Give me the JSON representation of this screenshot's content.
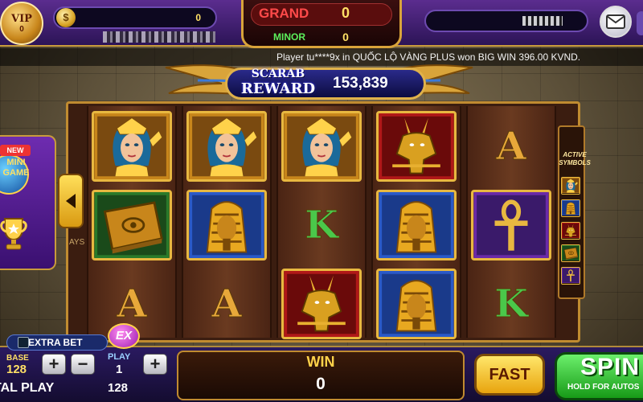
{
  "topbar": {
    "vip_label": "VIP",
    "vip_level": "0",
    "coin_symbol": "$",
    "coin_balance": "0"
  },
  "jackpot": {
    "grand_label": "GRAND",
    "grand_value": "0",
    "minor_label": "MINOR",
    "minor_value": "0"
  },
  "ticker": {
    "message": "Player tu****9x in  QUỐC LỘ VÀNG PLUS  won  BIG WIN 396.00 KVND."
  },
  "reward": {
    "title_line1": "SCARAB",
    "title_line2": "REWARD",
    "value": "153,839"
  },
  "reels": [
    [
      "queen",
      "book",
      "A"
    ],
    [
      "queen",
      "pharaoh",
      "A"
    ],
    [
      "queen",
      "K",
      "anubis"
    ],
    [
      "anubis",
      "pharaoh",
      "pharaoh"
    ],
    [
      "A",
      "ankh",
      "K"
    ]
  ],
  "side": {
    "mini_badge": "NEW",
    "mini_label": "MINI GAME",
    "side_text": "AYS"
  },
  "active_symbols": {
    "title": "ACTIVE SYMBOLS",
    "icons": [
      "queen",
      "pharaoh",
      "anubis",
      "book",
      "ankh"
    ]
  },
  "bottom": {
    "extra_bet_label": "EXTRA BET",
    "ex_label": "EX",
    "base_label": "BASE",
    "base_value": "128",
    "play_label": "PLAY",
    "play_value": "1",
    "total_label": "TAL PLAY",
    "total_value": "128",
    "win_label": "WIN",
    "win_value": "0",
    "fast_label": "FAST",
    "spin_label": "SPIN",
    "spin_sub": "HOLD FOR AUTOS"
  },
  "colors": {
    "letter_A": "#e8a83a",
    "letter_K": "#4ac84a",
    "gold": "#e8b840"
  }
}
